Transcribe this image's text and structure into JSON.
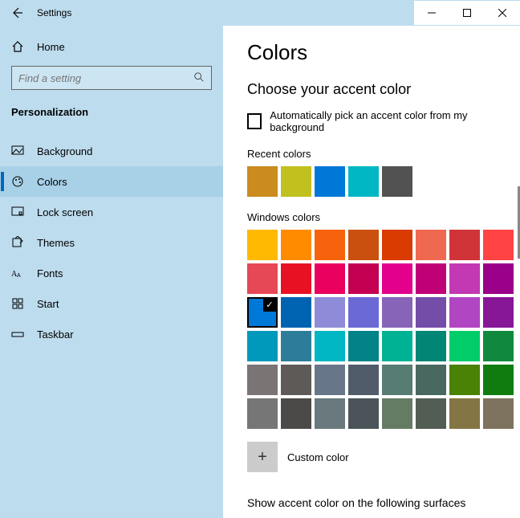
{
  "titlebar": {
    "title": "Settings"
  },
  "sidebar": {
    "home": "Home",
    "search_placeholder": "Find a setting",
    "category": "Personalization",
    "items": [
      {
        "label": "Background"
      },
      {
        "label": "Colors"
      },
      {
        "label": "Lock screen"
      },
      {
        "label": "Themes"
      },
      {
        "label": "Fonts"
      },
      {
        "label": "Start"
      },
      {
        "label": "Taskbar"
      }
    ],
    "selected_index": 1
  },
  "main": {
    "heading": "Colors",
    "accent_heading": "Choose your accent color",
    "auto_pick_label": "Automatically pick an accent color from my background",
    "auto_pick_checked": false,
    "recent_label": "Recent colors",
    "recent_colors": [
      "#ca8b1f",
      "#c0c01e",
      "#0078d7",
      "#00b7c3",
      "#525252"
    ],
    "windows_label": "Windows colors",
    "windows_colors": [
      "#ffb900",
      "#ff8c00",
      "#f7630c",
      "#ca5010",
      "#da3b01",
      "#ef6950",
      "#d13438",
      "#ff4343",
      "#e74856",
      "#e81123",
      "#ea005e",
      "#c30052",
      "#e3008c",
      "#bf0077",
      "#c239b3",
      "#9a0089",
      "#0078d7",
      "#0063b1",
      "#8e8cd8",
      "#6b69d6",
      "#8764b8",
      "#744da9",
      "#b146c2",
      "#881798",
      "#0099bc",
      "#2d7d9a",
      "#00b7c3",
      "#038387",
      "#00b294",
      "#018574",
      "#00cc6a",
      "#10893e",
      "#7a7574",
      "#5d5a58",
      "#68768a",
      "#515c6b",
      "#567c73",
      "#486860",
      "#498205",
      "#107c10",
      "#767676",
      "#4c4a48",
      "#69797e",
      "#4a5459",
      "#647c64",
      "#525e54",
      "#847545",
      "#7e735f"
    ],
    "windows_selected_index": 16,
    "custom_label": "Custom color",
    "surfaces_heading": "Show accent color on the following surfaces"
  }
}
